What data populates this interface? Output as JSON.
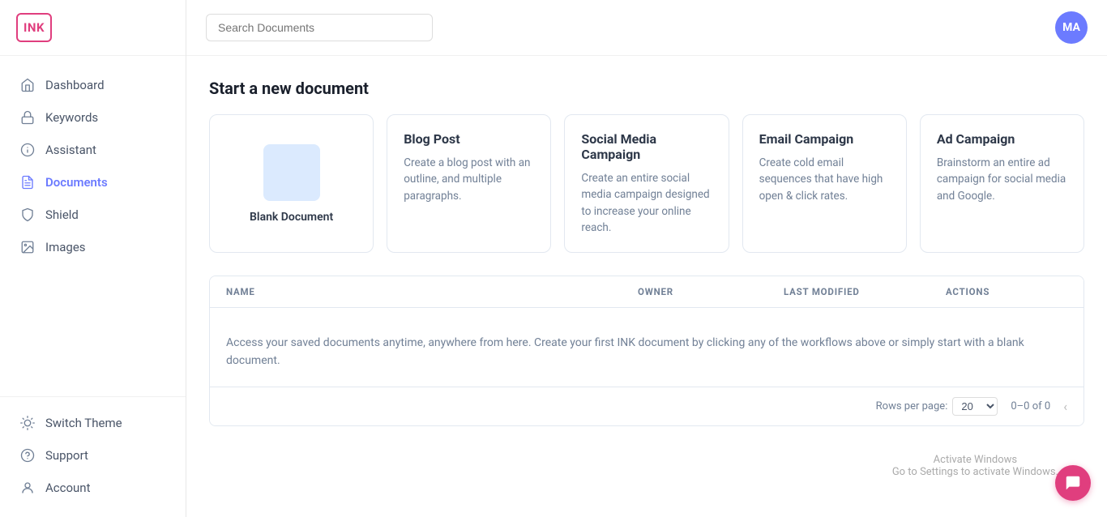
{
  "logo": {
    "text": "INK"
  },
  "avatar": {
    "initials": "MA"
  },
  "search": {
    "placeholder": "Search Documents"
  },
  "sidebar": {
    "items": [
      {
        "id": "dashboard",
        "label": "Dashboard",
        "active": false
      },
      {
        "id": "keywords",
        "label": "Keywords",
        "active": false
      },
      {
        "id": "assistant",
        "label": "Assistant",
        "active": false
      },
      {
        "id": "documents",
        "label": "Documents",
        "active": true
      },
      {
        "id": "shield",
        "label": "Shield",
        "active": false
      },
      {
        "id": "images",
        "label": "Images",
        "active": false
      }
    ],
    "bottom_items": [
      {
        "id": "switch-theme",
        "label": "Switch Theme"
      },
      {
        "id": "support",
        "label": "Support"
      },
      {
        "id": "account",
        "label": "Account"
      }
    ]
  },
  "main": {
    "section_title": "Start a new document",
    "cards": [
      {
        "id": "blank",
        "type": "blank",
        "label": "Blank Document"
      },
      {
        "id": "blog-post",
        "title": "Blog Post",
        "description": "Create a blog post with an outline, and multiple paragraphs."
      },
      {
        "id": "social-media",
        "title": "Social Media Campaign",
        "description": "Create an entire social media campaign designed to increase your online reach."
      },
      {
        "id": "email-campaign",
        "title": "Email Campaign",
        "description": "Create cold email sequences that have high open & click rates."
      },
      {
        "id": "ad-campaign",
        "title": "Ad Campaign",
        "description": "Brainstorm an entire ad campaign for social media and Google."
      }
    ],
    "table": {
      "columns": [
        "NAME",
        "OWNER",
        "LAST MODIFIED",
        "ACTIONS"
      ],
      "empty_message": "Access your saved documents anytime, anywhere from here. Create your first INK document by clicking any of the workflows above or simply start with a blank document.",
      "footer": {
        "rows_label": "Rows per page:",
        "rows_value": "20",
        "pagination": "0–0 of 0"
      }
    }
  },
  "activate_windows": {
    "line1": "Activate Windows",
    "line2": "Go to Settings to activate Windows."
  }
}
